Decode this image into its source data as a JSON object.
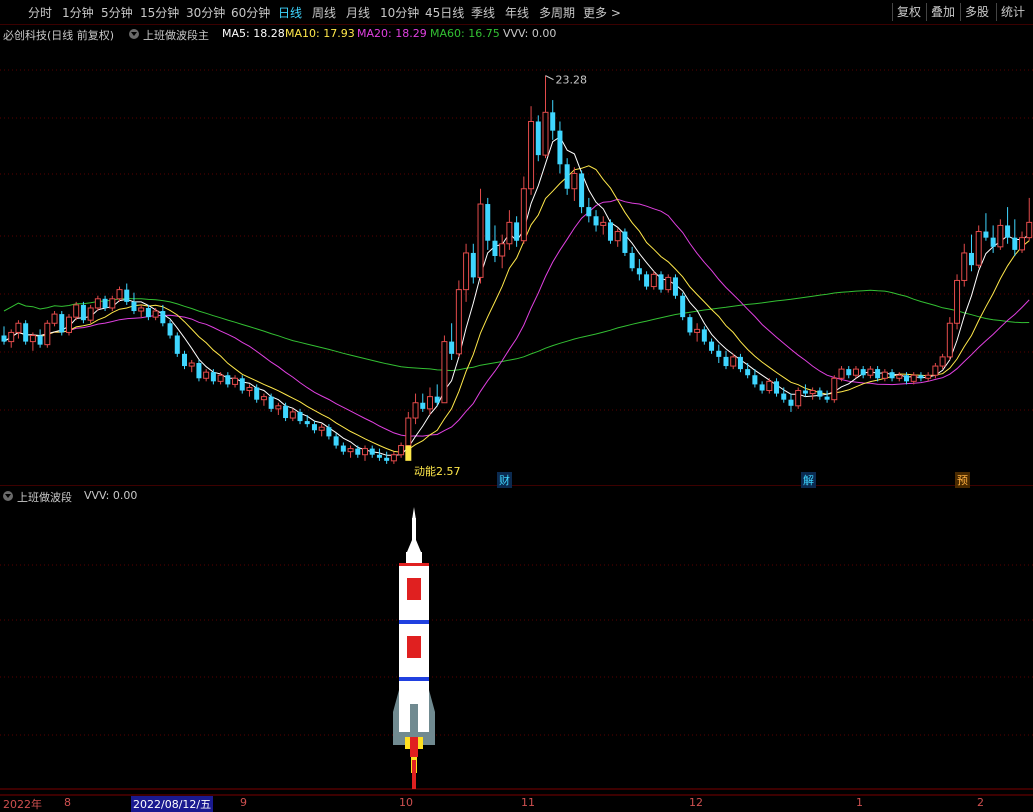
{
  "top_tabs": [
    "分时",
    "1分钟",
    "5分钟",
    "15分钟",
    "30分钟",
    "60分钟",
    "日线",
    "周线",
    "月线",
    "10分钟",
    "45日线",
    "季线",
    "年线",
    "多周期",
    "更多 >"
  ],
  "active_tab": "日线",
  "right_buttons": [
    "复权",
    "叠加",
    "多股",
    "统计"
  ],
  "stock": {
    "name": "必创科技(日线 前复权)",
    "indicator": "上班做波段主",
    "ma5_label": "MA5: 18.28",
    "ma10_label": "MA10: 17.93",
    "ma20_label": "MA20: 18.29",
    "ma60_label": "MA60: 16.75",
    "vvv_label": "VVV: 0.00"
  },
  "colors": {
    "up": "#e24b4b",
    "down": "#3fd6ff",
    "ma5": "#ffffff",
    "ma10": "#ffe84a",
    "ma20": "#e040e0",
    "ma60": "#33c033"
  },
  "price_annotations": {
    "high": "23.28",
    "low_note": "动能2.57"
  },
  "markers": {
    "cai": "财",
    "jie": "解",
    "yu": "预"
  },
  "sub_panel": {
    "name": "上班做波段",
    "vvv_label": "VVV: 0.00"
  },
  "date_axis": {
    "year": "2022年",
    "selected": "2022/08/12/五",
    "months": [
      "8",
      "9",
      "10",
      "11",
      "12",
      "1",
      "2"
    ]
  },
  "chart_data": {
    "type": "candlestick",
    "ylim": [
      12.2,
      24.4
    ],
    "candles": [
      [
        14.8,
        15.1,
        14.5,
        14.6
      ],
      [
        14.6,
        15.0,
        14.4,
        14.9
      ],
      [
        14.9,
        15.3,
        14.7,
        15.2
      ],
      [
        15.2,
        15.3,
        14.5,
        14.6
      ],
      [
        14.6,
        14.9,
        14.3,
        14.8
      ],
      [
        14.8,
        15.0,
        14.4,
        14.5
      ],
      [
        14.5,
        15.3,
        14.4,
        15.2
      ],
      [
        15.2,
        15.6,
        15.1,
        15.5
      ],
      [
        15.5,
        15.6,
        14.8,
        14.9
      ],
      [
        14.9,
        15.5,
        14.8,
        15.4
      ],
      [
        15.4,
        15.9,
        15.3,
        15.8
      ],
      [
        15.8,
        15.9,
        15.2,
        15.3
      ],
      [
        15.3,
        15.8,
        15.2,
        15.7
      ],
      [
        15.7,
        16.1,
        15.6,
        16.0
      ],
      [
        16.0,
        16.1,
        15.6,
        15.7
      ],
      [
        15.7,
        16.1,
        15.6,
        16.0
      ],
      [
        16.0,
        16.4,
        15.9,
        16.3
      ],
      [
        16.3,
        16.5,
        15.8,
        15.9
      ],
      [
        15.9,
        16.2,
        15.5,
        15.6
      ],
      [
        15.6,
        15.8,
        15.4,
        15.7
      ],
      [
        15.7,
        15.8,
        15.3,
        15.4
      ],
      [
        15.4,
        15.7,
        15.3,
        15.6
      ],
      [
        15.6,
        15.8,
        15.1,
        15.2
      ],
      [
        15.2,
        15.3,
        14.7,
        14.8
      ],
      [
        14.8,
        14.9,
        14.1,
        14.2
      ],
      [
        14.2,
        14.3,
        13.7,
        13.8
      ],
      [
        13.8,
        14.0,
        13.6,
        13.9
      ],
      [
        13.9,
        14.0,
        13.3,
        13.4
      ],
      [
        13.4,
        13.7,
        13.3,
        13.6
      ],
      [
        13.6,
        13.7,
        13.2,
        13.3
      ],
      [
        13.3,
        13.6,
        13.2,
        13.5
      ],
      [
        13.5,
        13.6,
        13.1,
        13.2
      ],
      [
        13.2,
        13.5,
        13.1,
        13.4
      ],
      [
        13.4,
        13.5,
        12.9,
        13.0
      ],
      [
        13.0,
        13.2,
        12.8,
        13.1
      ],
      [
        13.1,
        13.2,
        12.6,
        12.7
      ],
      [
        12.7,
        12.9,
        12.5,
        12.8
      ],
      [
        12.8,
        12.9,
        12.3,
        12.4
      ],
      [
        12.4,
        12.6,
        12.2,
        12.5
      ],
      [
        12.5,
        12.6,
        12.0,
        12.1
      ],
      [
        12.1,
        12.4,
        12.0,
        12.3
      ],
      [
        12.3,
        12.4,
        11.9,
        12.0
      ],
      [
        12.0,
        12.2,
        11.8,
        11.9
      ],
      [
        11.9,
        12.0,
        11.6,
        11.7
      ],
      [
        11.7,
        11.9,
        11.5,
        11.8
      ],
      [
        11.8,
        11.9,
        11.4,
        11.5
      ],
      [
        11.5,
        11.6,
        11.1,
        11.2
      ],
      [
        11.2,
        11.3,
        10.9,
        11.0
      ],
      [
        11.0,
        11.2,
        10.8,
        11.1
      ],
      [
        11.1,
        11.2,
        10.8,
        10.9
      ],
      [
        10.9,
        11.2,
        10.7,
        11.1
      ],
      [
        11.1,
        11.2,
        10.8,
        10.9
      ],
      [
        10.9,
        11.1,
        10.7,
        10.8
      ],
      [
        10.8,
        11.0,
        10.6,
        10.7
      ],
      [
        10.7,
        11.0,
        10.6,
        10.9
      ],
      [
        10.9,
        11.3,
        10.8,
        11.2
      ],
      [
        11.2,
        12.3,
        11.0,
        12.1
      ],
      [
        12.1,
        12.9,
        11.9,
        12.6
      ],
      [
        12.6,
        12.9,
        12.3,
        12.4
      ],
      [
        12.4,
        13.1,
        12.2,
        12.8
      ],
      [
        12.8,
        13.2,
        12.5,
        12.6
      ],
      [
        12.6,
        14.8,
        12.6,
        14.6
      ],
      [
        14.6,
        15.2,
        14.0,
        14.2
      ],
      [
        14.2,
        16.6,
        14.1,
        16.3
      ],
      [
        16.3,
        17.8,
        15.9,
        17.5
      ],
      [
        17.5,
        17.8,
        16.5,
        16.7
      ],
      [
        16.7,
        19.6,
        16.5,
        19.1
      ],
      [
        19.1,
        19.3,
        17.6,
        17.9
      ],
      [
        17.9,
        18.4,
        17.2,
        17.4
      ],
      [
        17.4,
        18.1,
        17.0,
        17.8
      ],
      [
        17.8,
        18.9,
        17.6,
        18.5
      ],
      [
        18.5,
        18.7,
        17.7,
        17.9
      ],
      [
        17.9,
        20.0,
        17.8,
        19.6
      ],
      [
        19.6,
        22.3,
        19.4,
        21.8
      ],
      [
        21.8,
        22.0,
        20.5,
        20.7
      ],
      [
        20.7,
        23.3,
        20.6,
        22.1
      ],
      [
        22.1,
        22.5,
        21.2,
        21.5
      ],
      [
        21.5,
        21.8,
        20.1,
        20.4
      ],
      [
        20.4,
        20.6,
        19.4,
        19.6
      ],
      [
        19.6,
        20.3,
        19.2,
        20.1
      ],
      [
        20.1,
        20.2,
        18.8,
        19.0
      ],
      [
        19.0,
        19.3,
        18.5,
        18.7
      ],
      [
        18.7,
        18.9,
        18.2,
        18.4
      ],
      [
        18.4,
        18.7,
        18.1,
        18.5
      ],
      [
        18.5,
        18.6,
        17.8,
        17.9
      ],
      [
        17.9,
        18.3,
        17.7,
        18.2
      ],
      [
        18.2,
        18.3,
        17.4,
        17.5
      ],
      [
        17.5,
        17.7,
        16.9,
        17.0
      ],
      [
        17.0,
        17.3,
        16.6,
        16.8
      ],
      [
        16.8,
        16.9,
        16.3,
        16.4
      ],
      [
        16.4,
        16.9,
        16.3,
        16.8
      ],
      [
        16.8,
        16.9,
        16.2,
        16.3
      ],
      [
        16.3,
        16.8,
        16.2,
        16.7
      ],
      [
        16.7,
        16.8,
        16.0,
        16.1
      ],
      [
        16.1,
        16.2,
        15.3,
        15.4
      ],
      [
        15.4,
        15.5,
        14.8,
        14.9
      ],
      [
        14.9,
        15.2,
        14.6,
        15.0
      ],
      [
        15.0,
        15.1,
        14.5,
        14.6
      ],
      [
        14.6,
        14.7,
        14.2,
        14.3
      ],
      [
        14.3,
        14.5,
        13.9,
        14.1
      ],
      [
        14.1,
        14.3,
        13.7,
        13.8
      ],
      [
        13.8,
        14.2,
        13.7,
        14.1
      ],
      [
        14.1,
        14.2,
        13.6,
        13.7
      ],
      [
        13.7,
        13.9,
        13.4,
        13.5
      ],
      [
        13.5,
        13.7,
        13.1,
        13.2
      ],
      [
        13.2,
        13.3,
        12.9,
        13.0
      ],
      [
        13.0,
        13.4,
        12.9,
        13.3
      ],
      [
        13.3,
        13.4,
        12.8,
        12.9
      ],
      [
        12.9,
        13.1,
        12.6,
        12.7
      ],
      [
        12.7,
        12.9,
        12.3,
        12.5
      ],
      [
        12.5,
        13.1,
        12.4,
        13.0
      ],
      [
        13.0,
        13.2,
        12.8,
        12.9
      ],
      [
        12.9,
        13.1,
        12.7,
        13.0
      ],
      [
        13.0,
        13.1,
        12.7,
        12.8
      ],
      [
        12.8,
        13.0,
        12.6,
        12.7
      ],
      [
        12.7,
        13.5,
        12.6,
        13.4
      ],
      [
        13.4,
        13.8,
        13.3,
        13.7
      ],
      [
        13.7,
        13.8,
        13.4,
        13.5
      ],
      [
        13.5,
        13.8,
        13.4,
        13.7
      ],
      [
        13.7,
        13.8,
        13.4,
        13.5
      ],
      [
        13.5,
        13.8,
        13.4,
        13.7
      ],
      [
        13.7,
        13.8,
        13.3,
        13.4
      ],
      [
        13.4,
        13.7,
        13.3,
        13.6
      ],
      [
        13.6,
        13.7,
        13.3,
        13.4
      ],
      [
        13.4,
        13.6,
        13.3,
        13.5
      ],
      [
        13.5,
        13.6,
        13.2,
        13.3
      ],
      [
        13.3,
        13.6,
        13.2,
        13.5
      ],
      [
        13.5,
        13.6,
        13.3,
        13.4
      ],
      [
        13.4,
        13.6,
        13.3,
        13.5
      ],
      [
        13.5,
        13.9,
        13.4,
        13.8
      ],
      [
        13.8,
        14.2,
        13.7,
        14.1
      ],
      [
        14.1,
        15.4,
        14.0,
        15.2
      ],
      [
        15.2,
        16.8,
        15.0,
        16.6
      ],
      [
        16.6,
        17.8,
        16.4,
        17.5
      ],
      [
        17.5,
        18.1,
        16.9,
        17.1
      ],
      [
        17.1,
        18.4,
        17.0,
        18.2
      ],
      [
        18.2,
        18.8,
        17.9,
        18.0
      ],
      [
        18.0,
        18.4,
        17.5,
        17.7
      ],
      [
        17.7,
        18.6,
        17.6,
        18.4
      ],
      [
        18.4,
        19.0,
        17.8,
        18.0
      ],
      [
        18.0,
        18.6,
        17.4,
        17.6
      ],
      [
        17.6,
        18.2,
        17.5,
        18.0
      ],
      [
        18.0,
        19.3,
        17.9,
        18.5
      ]
    ]
  }
}
